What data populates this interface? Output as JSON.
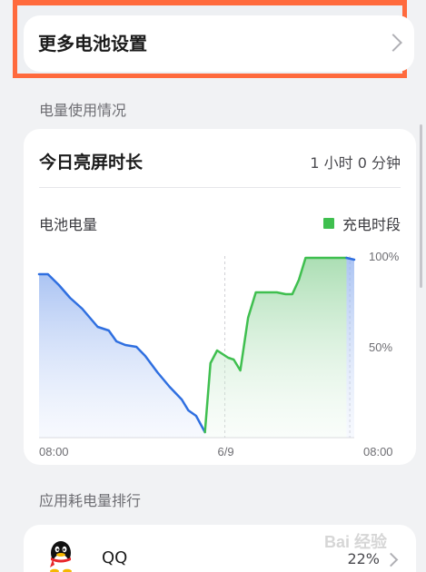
{
  "more_settings": {
    "label": "更多电池设置"
  },
  "section_usage": "电量使用情况",
  "screen_time": {
    "title": "今日亮屏时长",
    "value": "1 小时 0 分钟"
  },
  "chart_data": {
    "type": "area",
    "title": "电池电量",
    "legend": [
      {
        "name": "充电时段",
        "color": "#3fbf4f"
      }
    ],
    "y_tick_labels": [
      "100%",
      "50%"
    ],
    "x_tick_labels": [
      "08:00",
      "6/9",
      "08:00"
    ],
    "ylim": [
      0,
      100
    ],
    "x_unit": "hours since 08:00 (6/8)",
    "xlim": [
      0,
      24
    ],
    "series": [
      {
        "name": "discharging",
        "color": "#2f6fe0",
        "points": [
          [
            0,
            90
          ],
          [
            0.8,
            90
          ],
          [
            1.8,
            84
          ],
          [
            2.8,
            77
          ],
          [
            3.9,
            71
          ],
          [
            4.6,
            66
          ],
          [
            5.3,
            61
          ],
          [
            6.3,
            59
          ],
          [
            7.0,
            53
          ],
          [
            7.8,
            51
          ],
          [
            8.8,
            50
          ],
          [
            9.6,
            45
          ],
          [
            10.7,
            36
          ],
          [
            11.8,
            28
          ],
          [
            12.9,
            21
          ],
          [
            13.5,
            15
          ],
          [
            14.2,
            12
          ],
          [
            15.0,
            3
          ]
        ]
      },
      {
        "name": "charging",
        "color": "#3fbf4f",
        "points": [
          [
            15.0,
            3
          ],
          [
            15.5,
            41
          ],
          [
            16.1,
            48
          ],
          [
            17.1,
            44
          ],
          [
            17.6,
            43
          ],
          [
            18.2,
            37
          ],
          [
            18.9,
            66
          ],
          [
            19.6,
            80
          ],
          [
            20.4,
            80
          ],
          [
            21.5,
            80
          ],
          [
            22.3,
            79
          ],
          [
            22.9,
            79
          ],
          [
            23.5,
            87
          ],
          [
            24.1,
            99
          ],
          [
            25.6,
            99
          ],
          [
            27.8,
            99
          ]
        ]
      },
      {
        "name": "discharging-end",
        "color": "#2f6fe0",
        "points": [
          [
            27.8,
            99
          ],
          [
            28.5,
            98
          ]
        ]
      }
    ],
    "grid": "vertical dashed at 6/9 and end"
  },
  "ranking": {
    "label": "应用耗电量排行",
    "apps": [
      {
        "name": "QQ",
        "percent": "22%"
      }
    ]
  },
  "watermark": "Bai 经验"
}
